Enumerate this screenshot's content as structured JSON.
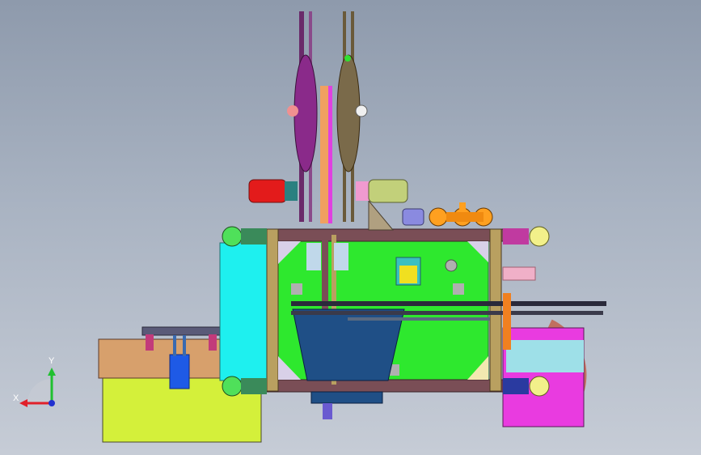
{
  "viewport": {
    "background_top": "#8e9aac",
    "background_bottom": "#c6ccd6"
  },
  "model": {
    "frame_color": "#7a4e56",
    "panel_color": "#2ee82e",
    "hopper_color": "#1f4f86",
    "side_cover_color": "#1ef0ef",
    "left_table_color": "#d7a06c",
    "left_base_color": "#d4f03a",
    "right_box_color": "#e93be0",
    "motor_color": "#e31b1b",
    "right_motor_color": "#c2d07a",
    "wheel_color": "#4fe05a",
    "right_wheel_color": "#f2f08a",
    "conveyor_color": "#ffa020"
  },
  "triad": {
    "x_label": "X",
    "y_label": "Y",
    "x_color": "#e0202a",
    "y_color": "#20c030",
    "z_color": "#2030d0"
  }
}
